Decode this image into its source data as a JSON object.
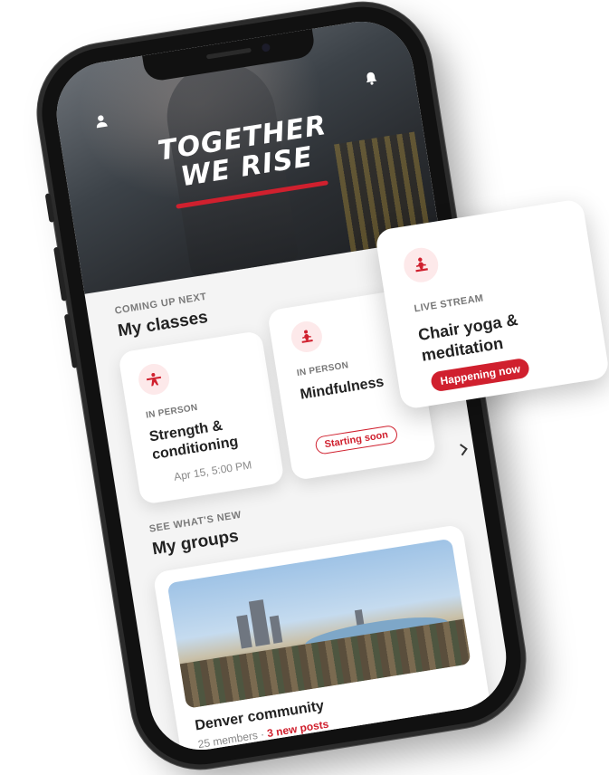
{
  "hero": {
    "title_line1": "TOGETHER",
    "title_line2": "WE RISE",
    "profile_icon": "person-icon",
    "notification_icon": "bell-icon"
  },
  "classes": {
    "section_label": "COMING UP NEXT",
    "section_title": "My classes",
    "items": [
      {
        "icon": "weightlifting-icon",
        "tag": "IN PERSON",
        "name_line1": "Strength &",
        "name_line2": "conditioning",
        "time": "Apr 15, 5:00 PM"
      },
      {
        "icon": "meditation-icon",
        "tag": "IN PERSON",
        "name": "Mindfulness",
        "status": "Starting soon"
      },
      {
        "icon": "meditation-icon",
        "tag": "LIVE STREAM",
        "name_line1": "Chair yoga &",
        "name_line2": "meditation",
        "status": "Happening now"
      }
    ]
  },
  "groups": {
    "section_label": "SEE WHAT'S NEW",
    "section_title": "My groups",
    "items": [
      {
        "name": "Denver community",
        "members": "25 members",
        "separator": " · ",
        "new_posts": "3 new posts"
      }
    ]
  },
  "colors": {
    "accent": "#d0202e",
    "card_bg": "#ffffff",
    "screen_bg": "#f4f4f4"
  }
}
